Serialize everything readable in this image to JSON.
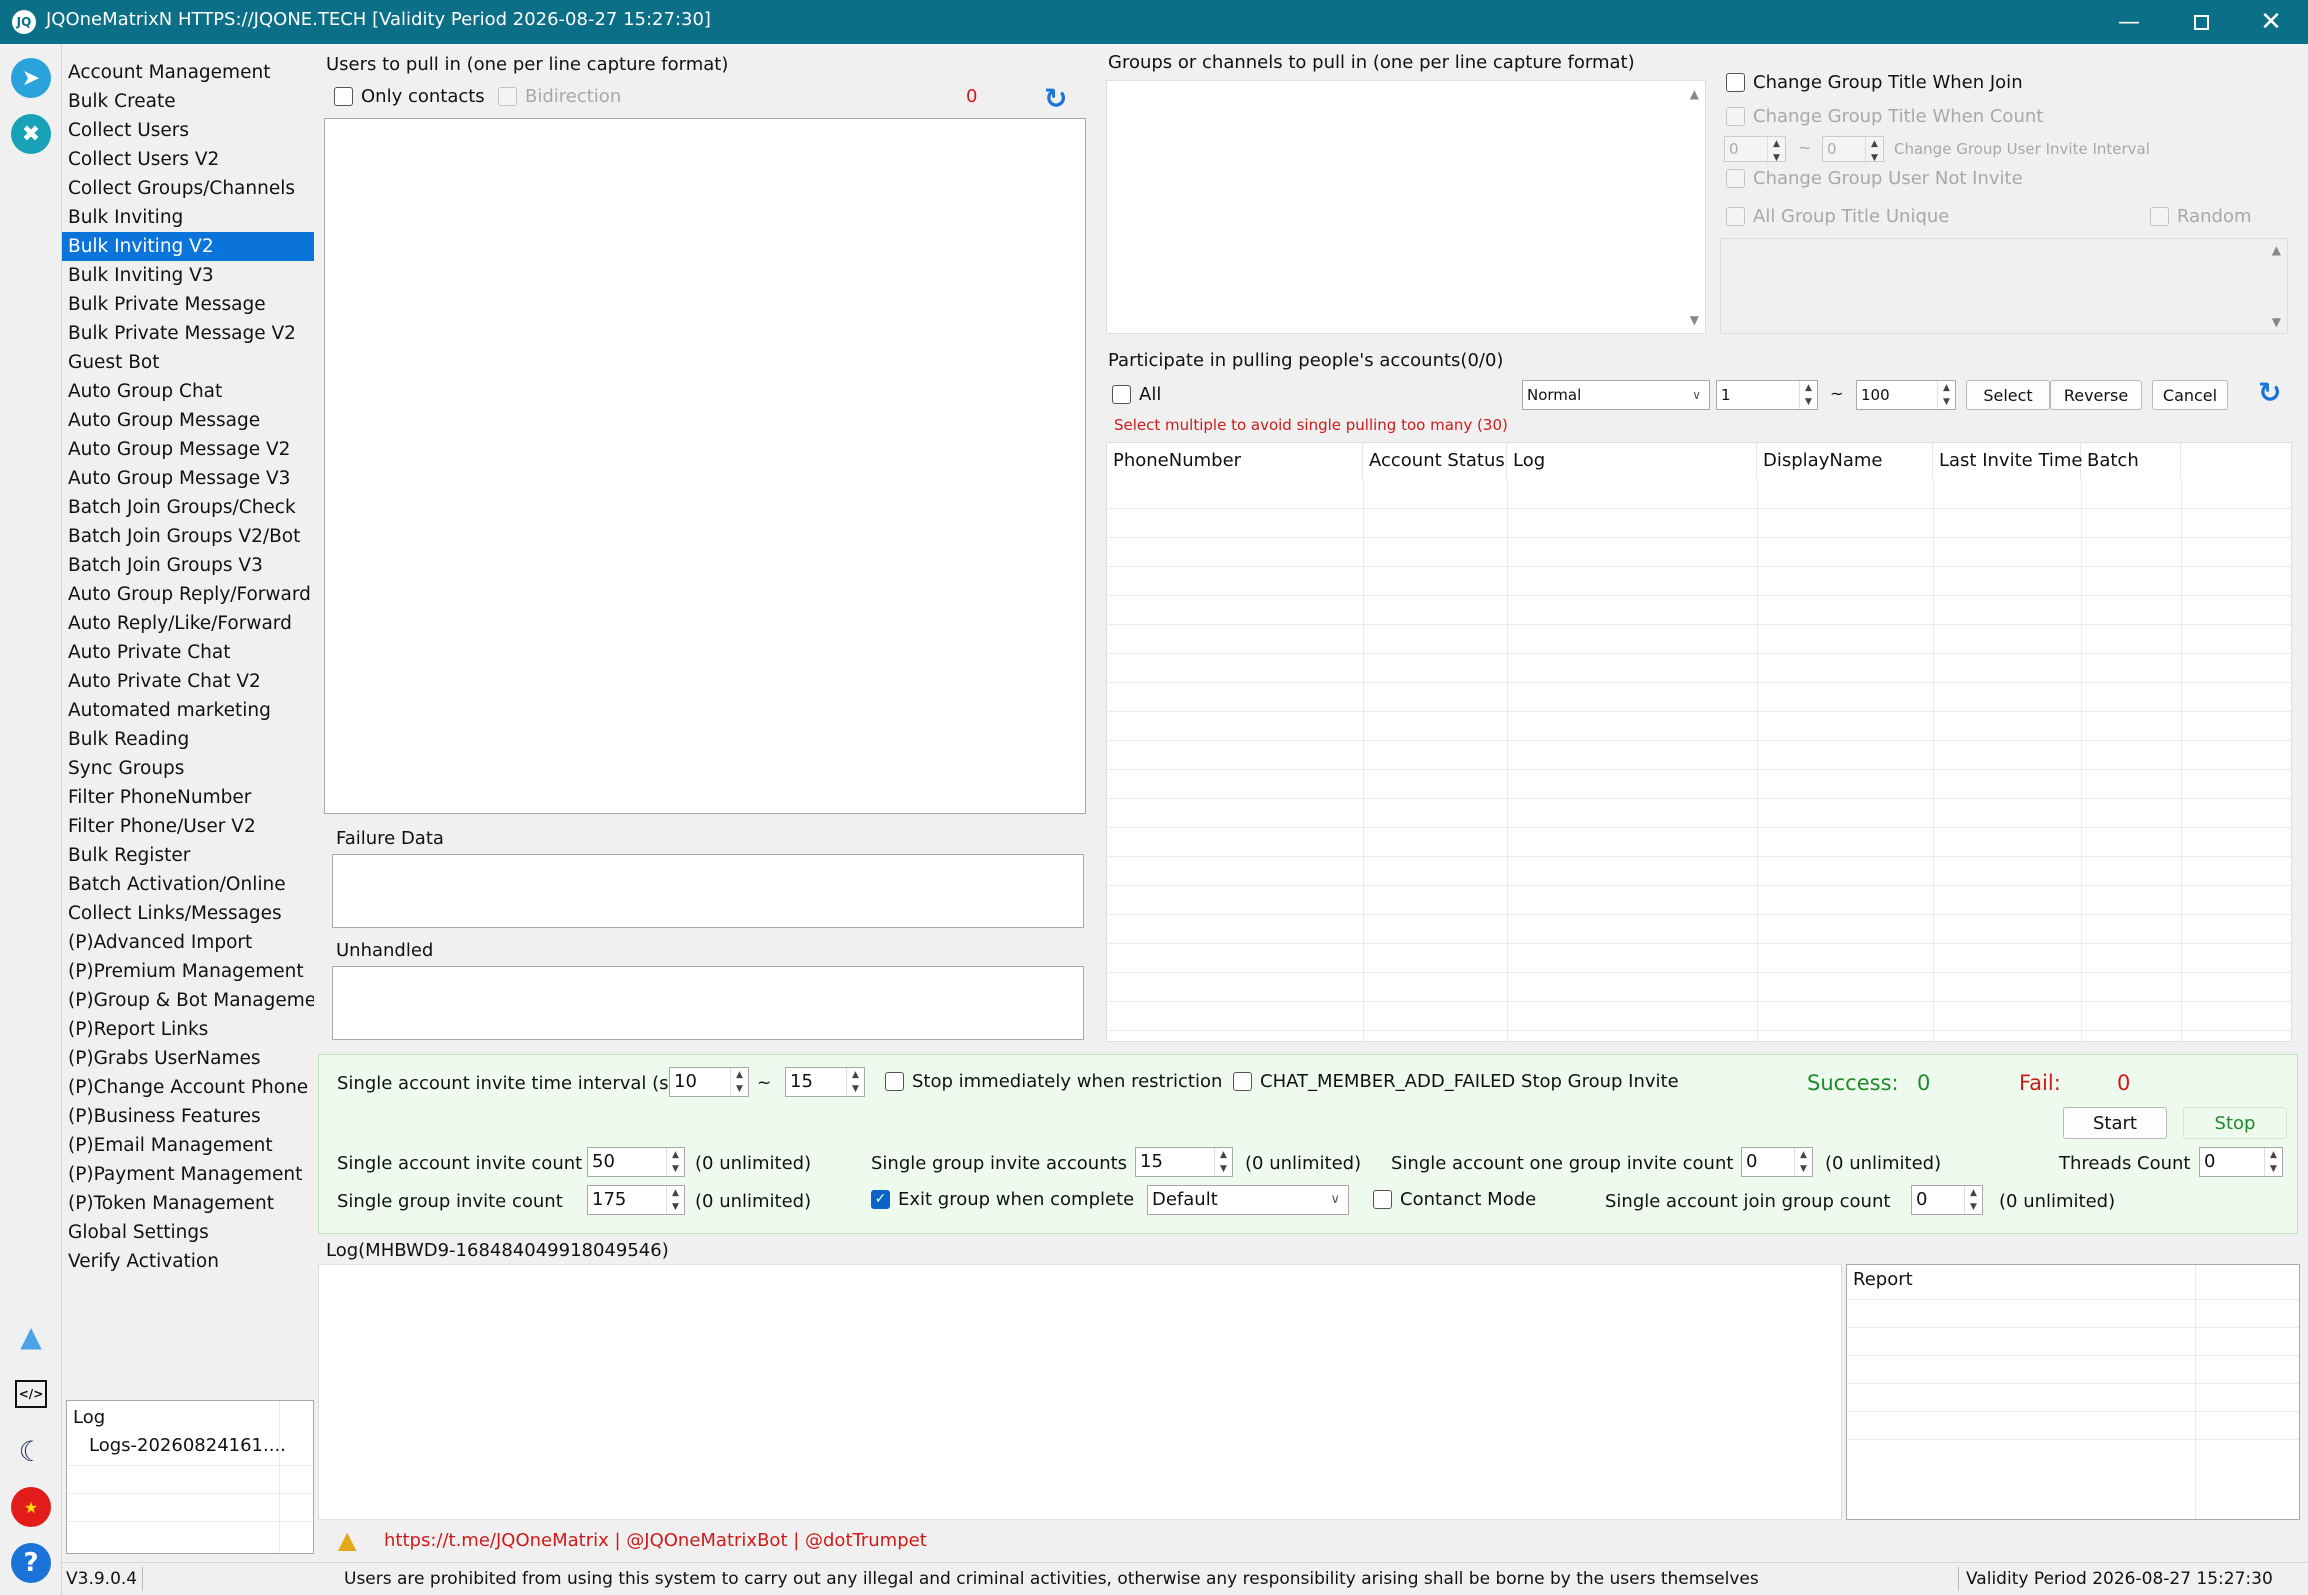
{
  "app": {
    "title": "JQOneMatrixN HTTPS://JQONE.TECH  [Validity Period 2026-08-27 15:27:30]"
  },
  "menu": [
    "Account Management",
    "Bulk Create",
    "Collect Users",
    "Collect Users V2",
    "Collect Groups/Channels",
    "Bulk Inviting",
    "Bulk Inviting V2",
    "Bulk Inviting V3",
    "Bulk Private Message",
    "Bulk Private Message V2",
    "Guest Bot",
    "Auto Group Chat",
    "Auto Group Message",
    "Auto Group Message V2",
    "Auto Group Message V3",
    "Batch Join Groups/Check",
    "Batch Join Groups V2/Bot",
    "Batch Join Groups V3",
    "Auto Group Reply/Forward",
    "Auto Reply/Like/Forward",
    "Auto Private Chat",
    "Auto Private Chat V2",
    "Automated marketing",
    "Bulk Reading",
    "Sync Groups",
    "Filter PhoneNumber",
    "Filter Phone/User V2",
    "Bulk Register",
    "Batch Activation/Online",
    "Collect Links/Messages",
    "(P)Advanced Import",
    "(P)Premium Management",
    "(P)Group & Bot Managemer",
    "(P)Report Links",
    "(P)Grabs UserNames",
    "(P)Change Account Phone",
    "(P)Business Features",
    "(P)Email Management",
    "(P)Payment Management",
    "(P)Token Management",
    "Global Settings",
    "Verify Activation"
  ],
  "menu_selected_index": 6,
  "leftlog": {
    "header": "Log",
    "item": "Logs-20260824161...."
  },
  "users": {
    "label": "Users to pull in (one per line capture format)",
    "only_contacts": "Only contacts",
    "bidirection": "Bidirection",
    "count": "0"
  },
  "failure": {
    "label": "Failure Data"
  },
  "unhandled": {
    "label": "Unhandled"
  },
  "groups": {
    "label": "Groups or channels to pull in (one per line capture format)"
  },
  "opts": {
    "change_title_join": "Change Group Title When Join",
    "change_title_count": "Change Group Title When Count",
    "interval_from": "0",
    "tilde": "~",
    "interval_to": "0",
    "interval_label": "Change Group User Invite Interval",
    "not_invite": "Change Group User Not Invite",
    "unique": "All Group Title Unique",
    "random": "Random"
  },
  "accounts": {
    "label": "Participate in pulling people's accounts(0/0)",
    "all": "All",
    "mode": "Normal",
    "from": "1",
    "tilde": "~",
    "to": "100",
    "select": "Select",
    "reverse": "Reverse",
    "cancel": "Cancel",
    "hint": "Select multiple to avoid single pulling too many (30)",
    "columns": [
      "PhoneNumber",
      "Account Status",
      "Log",
      "DisplayName",
      "Last Invite Time",
      "Batch"
    ]
  },
  "settings": {
    "interval_label": "Single account invite time interval (s)",
    "interval_from": "10",
    "tilde": "~",
    "interval_to": "15",
    "stop_restriction": "Stop immediately when restriction",
    "chat_member": "CHAT_MEMBER_ADD_FAILED Stop Group Invite",
    "success_label": "Success:",
    "success_val": "0",
    "fail_label": "Fail:",
    "fail_val": "0",
    "start": "Start",
    "stop": "Stop",
    "acc_invite_label": "Single account invite count",
    "acc_invite_val": "50",
    "unlimited": "(0 unlimited)",
    "grp_acc_label": "Single group invite accounts",
    "grp_acc_val": "15",
    "one_grp_label": "Single account one group invite count",
    "one_grp_val": "0",
    "threads_label": "Threads Count",
    "threads_val": "0",
    "grp_invite_label": "Single group invite count",
    "grp_invite_val": "175",
    "exit_group": "Exit group when complete",
    "default_opt": "Default",
    "contact_mode": "Contanct Mode",
    "join_grp_label": "Single account join group count",
    "join_grp_val": "0"
  },
  "log": {
    "label": "Log(MHBWD9-168484049918049546)",
    "report": "Report"
  },
  "links": "https://t.me/JQOneMatrix | @JQOneMatrixBot | @dotTrumpet",
  "status": {
    "version": "V3.9.0.4",
    "warning": "Users are prohibited from using this system to carry out any illegal and criminal activities, otherwise any responsibility arising shall be borne by the users themselves",
    "validity": "Validity Period 2026-08-27 15:27:30"
  },
  "colors": {
    "titlebar": "#0b6f87",
    "selected": "#0a74da",
    "success": "#1f8a2a",
    "fail": "#d01a1a",
    "panel_green": "#eefaee"
  }
}
